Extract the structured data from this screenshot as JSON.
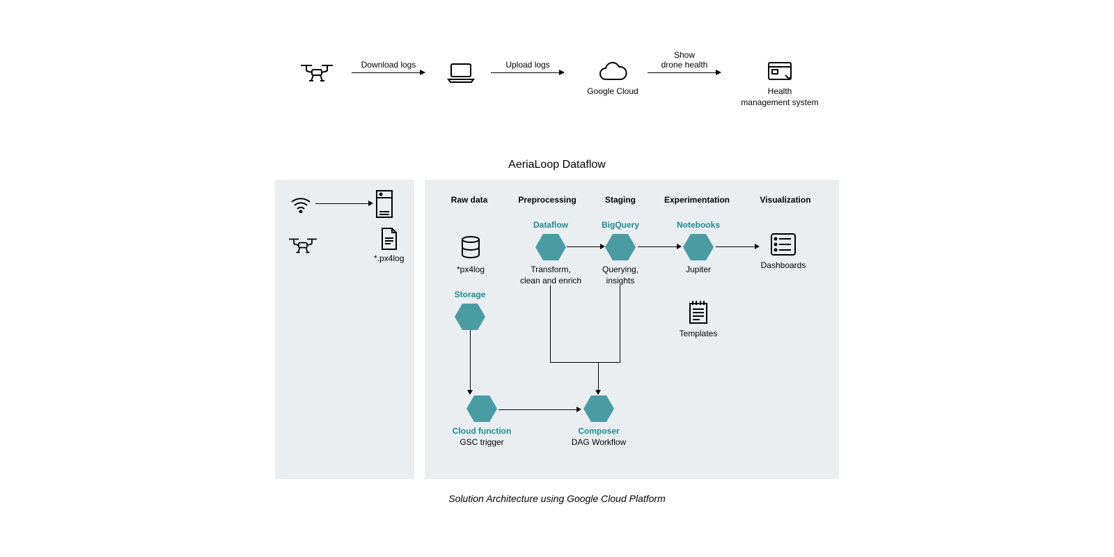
{
  "top_flow": {
    "arrow1_label": "Download logs",
    "arrow2_label": "Upload logs",
    "arrow3_label": "Show\ndrone health",
    "node_cloud": "Google Cloud",
    "node_hms": "Health\nmanagement system"
  },
  "section_title": "AeriaLoop Dataflow",
  "left_panel": {
    "file_label": "*.px4log"
  },
  "right_panel": {
    "columns": {
      "raw": "Raw data",
      "pre": "Preprocessing",
      "stg": "Staging",
      "exp": "Experimentation",
      "viz": "Visualization"
    },
    "raw_data": {
      "db_label": "*px4log",
      "storage_teal": "Storage"
    },
    "preprocessing": {
      "dataflow_teal": "Dataflow",
      "dataflow_sub": "Transform,\nclean and enrich",
      "cloudfn_teal": "Cloud function",
      "cloudfn_sub": "GSC trigger"
    },
    "staging": {
      "bq_teal": "BigQuery",
      "bq_sub": "Querying,\ninsights",
      "composer_teal": "Composer",
      "composer_sub": "DAG Workflow"
    },
    "experimentation": {
      "nb_teal": "Notebooks",
      "nb_sub": "Jupiter",
      "templates_label": "Templates"
    },
    "visualization": {
      "dash_label": "Dashboards"
    }
  },
  "caption": "Solution Architecture using Google Cloud Platform"
}
